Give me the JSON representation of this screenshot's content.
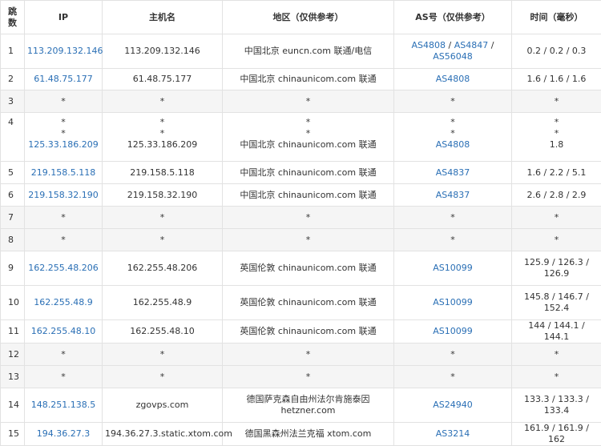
{
  "headers": {
    "hop_line1": "跳",
    "hop_line2": "数",
    "ip": "IP",
    "hostname": "主机名",
    "region": "地区（仅供参考）",
    "as": "AS号（仅供参考）",
    "time": "时间（毫秒）"
  },
  "rows": [
    {
      "hop": "1",
      "ip": "113.209.132.146",
      "host": "113.209.132.146",
      "region": "中国北京 euncn.com 联通/电信",
      "as": [
        "AS4808",
        "AS4847",
        "AS56048"
      ],
      "time": "0.2 / 0.2 / 0.3"
    },
    {
      "hop": "2",
      "ip": "61.48.75.177",
      "host": "61.48.75.177",
      "region": "中国北京 chinaunicom.com 联通",
      "as": [
        "AS4808"
      ],
      "time": "1.6 / 1.6 / 1.6"
    },
    {
      "hop": "3",
      "ip": "*",
      "host": "*",
      "region": "*",
      "as": [
        "*"
      ],
      "time": "*"
    },
    {
      "hop": "4",
      "star": "*",
      "ip": "125.33.186.209",
      "host": "125.33.186.209",
      "region": "中国北京 chinaunicom.com 联通",
      "as": [
        "AS4808"
      ],
      "time": "1.8"
    },
    {
      "hop": "5",
      "ip": "219.158.5.118",
      "host": "219.158.5.118",
      "region": "中国北京 chinaunicom.com 联通",
      "as": [
        "AS4837"
      ],
      "time": "1.6 / 2.2 / 5.1"
    },
    {
      "hop": "6",
      "ip": "219.158.32.190",
      "host": "219.158.32.190",
      "region": "中国北京 chinaunicom.com 联通",
      "as": [
        "AS4837"
      ],
      "time": "2.6 / 2.8 / 2.9"
    },
    {
      "hop": "7",
      "ip": "*",
      "host": "*",
      "region": "*",
      "as": [
        "*"
      ],
      "time": "*"
    },
    {
      "hop": "8",
      "ip": "*",
      "host": "*",
      "region": "*",
      "as": [
        "*"
      ],
      "time": "*"
    },
    {
      "hop": "9",
      "ip": "162.255.48.206",
      "host": "162.255.48.206",
      "region": "英国伦敦 chinaunicom.com 联通",
      "as": [
        "AS10099"
      ],
      "time": "125.9 / 126.3 / 126.9"
    },
    {
      "hop": "10",
      "ip": "162.255.48.9",
      "host": "162.255.48.9",
      "region": "英国伦敦 chinaunicom.com 联通",
      "as": [
        "AS10099"
      ],
      "time": "145.8 / 146.7 / 152.4"
    },
    {
      "hop": "11",
      "ip": "162.255.48.10",
      "host": "162.255.48.10",
      "region": "英国伦敦 chinaunicom.com 联通",
      "as": [
        "AS10099"
      ],
      "time": "144 / 144.1 / 144.1"
    },
    {
      "hop": "12",
      "ip": "*",
      "host": "*",
      "region": "*",
      "as": [
        "*"
      ],
      "time": "*"
    },
    {
      "hop": "13",
      "ip": "*",
      "host": "*",
      "region": "*",
      "as": [
        "*"
      ],
      "time": "*"
    },
    {
      "hop": "14",
      "ip": "148.251.138.5",
      "host": "zgovps.com",
      "region": "德国萨克森自由州法尔肯施泰因 hetzner.com",
      "as": [
        "AS24940"
      ],
      "time": "133.3 / 133.3 / 133.4"
    },
    {
      "hop": "15",
      "ip": "194.36.27.3",
      "host": "194.36.27.3.static.xtom.com",
      "region": "德国黑森州法兰克福 xtom.com",
      "as": [
        "AS3214"
      ],
      "time": "161.9 / 161.9 / 162"
    }
  ],
  "colors": {
    "link": "#2a6fb5",
    "row_alt": "#f5f5f5",
    "border": "#e2e2e2",
    "text": "#333333"
  }
}
